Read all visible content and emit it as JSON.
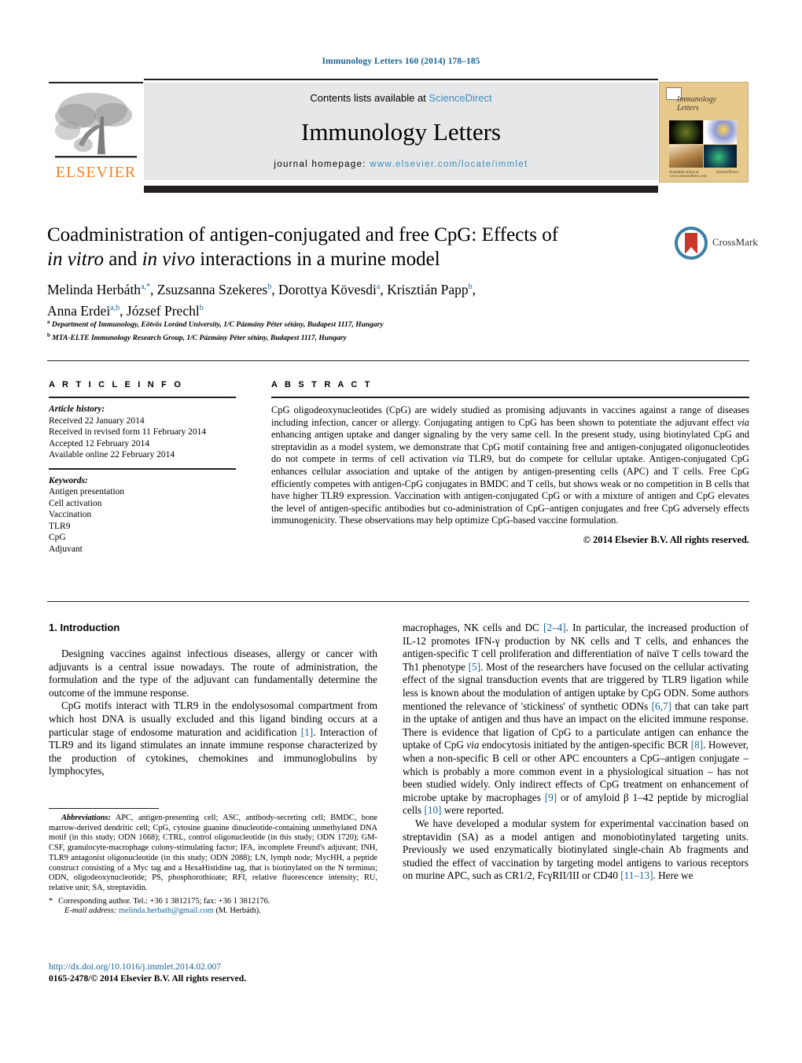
{
  "running_head": "Immunology Letters 160 (2014) 178–185",
  "masthead": {
    "contents_prefix": "Contents lists available at ",
    "sciencedirect": "ScienceDirect",
    "journal_name": "Immunology Letters",
    "homepage_prefix": "journal homepage: ",
    "homepage_url": "www.elsevier.com/locate/immlet",
    "publisher_wordmark": "ELSEVIER",
    "cover_title": "Immunology Letters",
    "cover_footer_left": "Available online at www.sciencedirect.com",
    "cover_footer_right": "ScienceDirect"
  },
  "article": {
    "title_line1": "Coadministration of antigen-conjugated and free CpG: Effects of",
    "title_line2_italic1": "in vitro",
    "title_line2_mid": " and ",
    "title_line2_italic2": "in vivo",
    "title_line2_end": " interactions in a murine model",
    "crossmark_label": "CrossMark",
    "authors_line1": "Melinda Herbáth",
    "authors_rest": "Zsuzsanna Szekeres, Dorottya Kövesdi, Krisztián Papp, Anna Erdei, József Prechl",
    "affiliation_a": "Department of Immunology, Eötvös Loránd University, 1/C Pázmány Péter sétány, Budapest 1117, Hungary",
    "affiliation_b": "MTA-ELTE Immunology Research Group, 1/C Pázmány Péter sétány, Budapest 1117, Hungary"
  },
  "article_info": {
    "heading": "A R T I C L E    I N F O",
    "history_label": "Article history:",
    "history": [
      "Received 22 January 2014",
      "Received in revised form 11 February 2014",
      "Accepted 12 February 2014",
      "Available online 22 February 2014"
    ],
    "keywords_label": "Keywords:",
    "keywords": [
      "Antigen presentation",
      "Cell activation",
      "Vaccination",
      "TLR9",
      "CpG",
      "Adjuvant"
    ]
  },
  "abstract": {
    "heading": "A B S T R A C T",
    "p1": "CpG oligodeoxynucleotides (CpG) are widely studied as promising adjuvants in vaccines against a range of diseases including infection, cancer or allergy. Conjugating antigen to CpG has been shown to potentiate the adjuvant effect ",
    "via1": "via",
    "p2": " enhancing antigen uptake and danger signaling by the very same cell. In the present study, using biotinylated CpG and streptavidin as a model system, we demonstrate that CpG motif containing free and antigen-conjugated oligonucleotides do not compete in terms of cell activation ",
    "via2": "via",
    "p3": " TLR9, but do compete for cellular uptake. Antigen-conjugated CpG enhances cellular association and uptake of the antigen by antigen-presenting cells (APC) and T cells. Free CpG efficiently competes with antigen-CpG conjugates in BMDC and T cells, but shows weak or no competition in B cells that have higher TLR9 expression. Vaccination with antigen-conjugated CpG or with a mixture of antigen and CpG elevates the level of antigen-specific antibodies but co-administration of CpG–antigen conjugates and free CpG adversely effects immunogenicity. These observations may help optimize CpG-based vaccine formulation.",
    "copyright": "© 2014 Elsevier B.V. All rights reserved."
  },
  "introduction": {
    "heading": "1.  Introduction",
    "left_p1": "Designing vaccines against infectious diseases, allergy or cancer with adjuvants is a central issue nowadays. The route of administration, the formulation and the type of the adjuvant can fundamentally determine the outcome of the immune response.",
    "left_p2_a": "CpG motifs interact with TLR9 in the endolysosomal compartment from which host DNA is usually excluded and this ligand binding occurs at a particular stage of endosome maturation and acidification ",
    "left_p2_ref1": "[1]",
    "left_p2_b": ". Interaction of TLR9 and its ligand stimulates an innate immune response characterized by the production of cytokines, chemokines and immunoglobulins by lymphocytes,",
    "right_p1_a": "macrophages, NK cells and DC ",
    "right_p1_ref1": "[2–4]",
    "right_p1_b": ". In particular, the increased production of IL-12 promotes IFN-γ production by NK cells and T cells, and enhances the antigen-specific T cell proliferation and differentiation of naïve T cells toward the Th1 phenotype ",
    "right_p1_ref2": "[5]",
    "right_p1_c": ". Most of the researchers have focused on the cellular activating effect of the signal transduction events that are triggered by TLR9 ligation while less is known about the modulation of antigen uptake by CpG ODN. Some authors mentioned the relevance of 'stickiness' of synthetic ODNs ",
    "right_p1_ref3": "[6,7]",
    "right_p1_d": " that can take part in the uptake of antigen and thus have an impact on the elicited immune response. There is evidence that ligation of CpG to a particulate antigen can enhance the uptake of CpG ",
    "right_p1_via": "via",
    "right_p1_e": " endocytosis initiated by the antigen-specific BCR ",
    "right_p1_ref4": "[8]",
    "right_p1_f": ". However, when a non-specific B cell or other APC encounters a CpG–antigen conjugate – which is probably a more common event in a physiological situation – has not been studied widely. Only indirect effects of CpG treatment on enhancement of microbe uptake by macrophages ",
    "right_p1_ref5": "[9]",
    "right_p1_g": " or of amyloid β 1–42 peptide by microglial cells ",
    "right_p1_ref6": "[10]",
    "right_p1_h": " were reported.",
    "right_p2_a": "We have developed a modular system for experimental vaccination based on streptavidin (SA) as a model antigen and monobiotinylated targeting units. Previously we used enzymatically biotinylated single-chain Ab fragments and studied the effect of vaccination by targeting model antigens to various receptors on murine APC, such as CR1/2, FcγRII/III or CD40 ",
    "right_p2_ref1": "[11–13]",
    "right_p2_b": ". Here we"
  },
  "footnotes": {
    "abbr_label": "Abbreviations:",
    "abbr_text": " APC, antigen-presenting cell; ASC, antibody-secreting cell; BMDC, bone marrow-derived dendritic cell; CpG, cytosine guanine dinucleotide-containing unmethylated DNA motif (in this study; ODN 1668); CTRL, control oligonucleotide (in this study; ODN 1720); GM-CSF, granulocyte-macrophage colony-stimulating factor; IFA, incomplete Freund's adjuvant; INH, TLR9 antagonist oligonucleotide (in this study; ODN 2088); LN, lymph node; MycHH, a peptide construct consisting of a Myc tag and a HexaHistidine tag, that is biotinylated on the N terminus; ODN, oligodeoxynucleotide; PS, phosphorothioate; RFI, relative fluorescence intensity; RU, relative unit; SA, streptavidin.",
    "corresponding": "Corresponding author. Tel.: +36 1 3812175; fax: +36 1 3812176.",
    "email_label": "E-mail address:",
    "email": "melinda.herbath@gmail.com",
    "email_suffix": " (M. Herbáth).",
    "doi": "http://dx.doi.org/10.1016/j.immlet.2014.02.007",
    "issn_line": "0165-2478/© 2014 Elsevier B.V. All rights reserved."
  },
  "colors": {
    "link": "#1a6496",
    "sciencedirect": "#3c8dbc",
    "elsevier_orange": "#f5821f",
    "rule_dark": "#231f20",
    "masthead_gray": "#e6e7e8"
  }
}
